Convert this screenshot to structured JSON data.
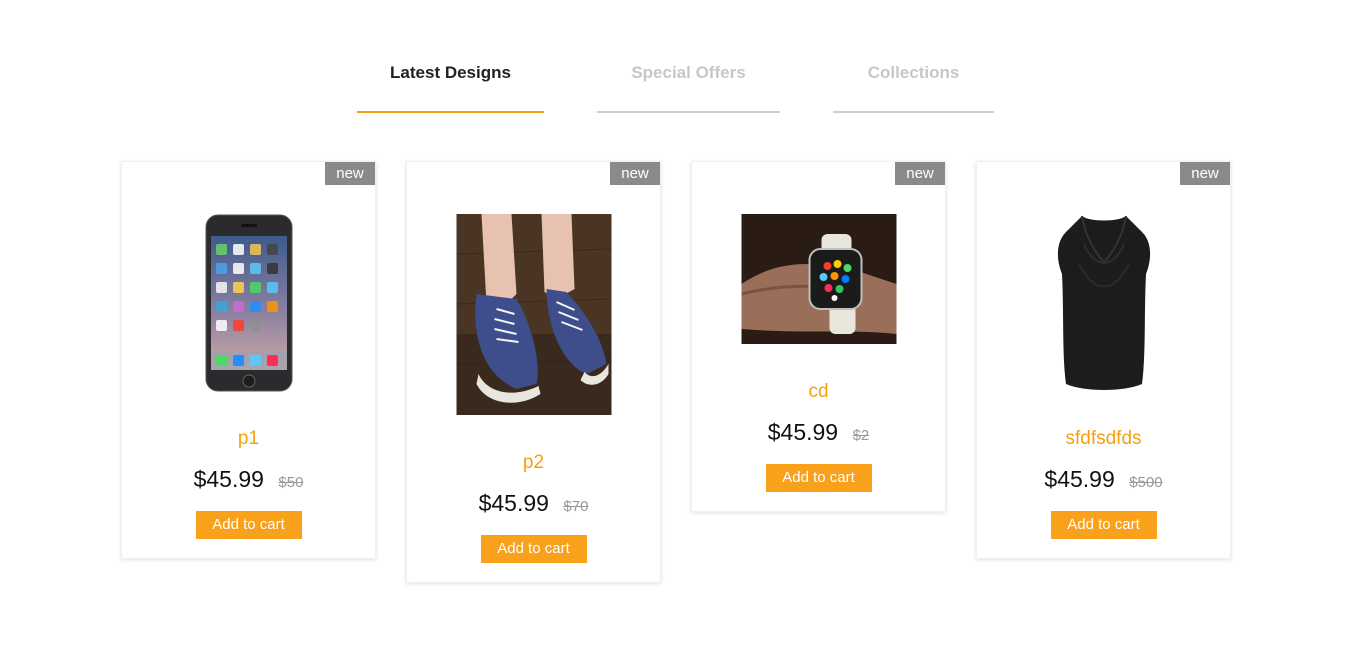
{
  "tabs": [
    {
      "label": "Latest Designs",
      "active": true
    },
    {
      "label": "Special Offers",
      "active": false
    },
    {
      "label": "Collections",
      "active": false
    }
  ],
  "products": [
    {
      "badge": "new",
      "name": "p1",
      "price": "$45.99",
      "old_price": "$50",
      "cart_label": "Add to cart",
      "image": "smartphone-image"
    },
    {
      "badge": "new",
      "name": "p2",
      "price": "$45.99",
      "old_price": "$70",
      "cart_label": "Add to cart",
      "image": "sneakers-image"
    },
    {
      "badge": "new",
      "name": "cd",
      "price": "$45.99",
      "old_price": "$2",
      "cart_label": "Add to cart",
      "image": "smartwatch-image"
    },
    {
      "badge": "new",
      "name": "sfdfsdfds",
      "price": "$45.99",
      "old_price": "$500",
      "cart_label": "Add to cart",
      "image": "black-top-image"
    }
  ],
  "colors": {
    "accent": "#f5a10f",
    "button": "#f9a11b",
    "badge": "#8a8a8a",
    "inactive_tab": "#c7c7c7"
  }
}
